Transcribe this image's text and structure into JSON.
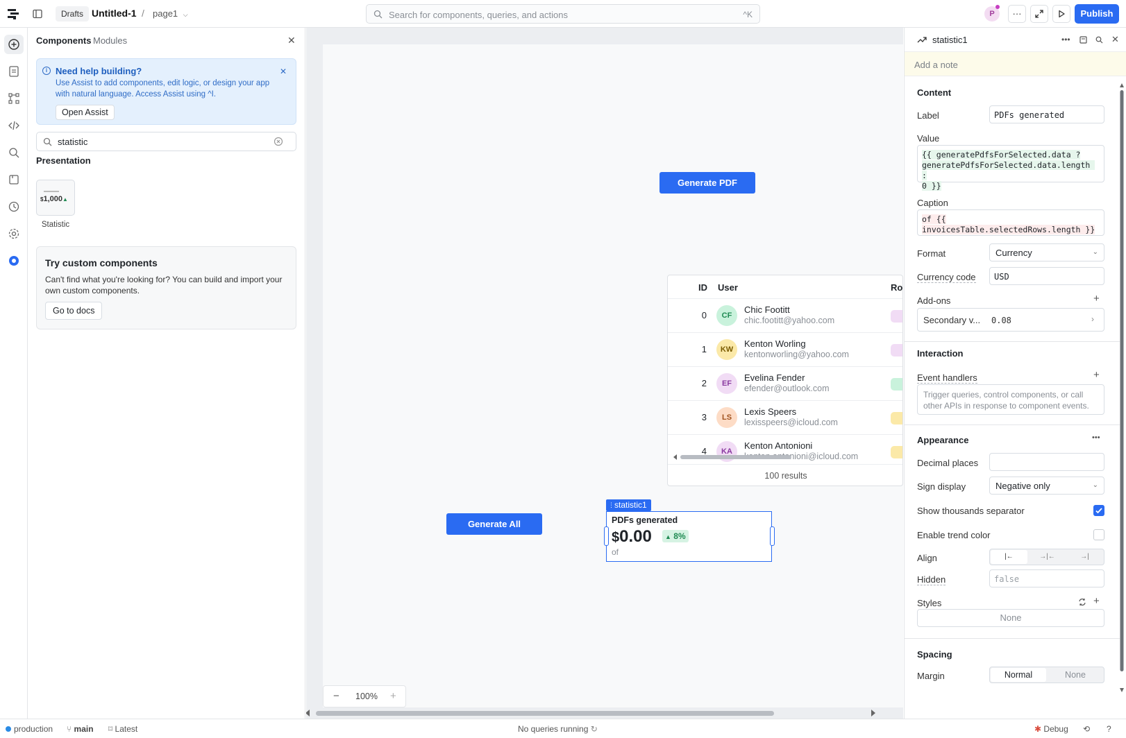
{
  "topbar": {
    "drafts": "Drafts",
    "title": "Untitled-1",
    "separator": "/",
    "page": "page1",
    "search_placeholder": "Search for components, queries, and actions",
    "search_shortcut": "^K",
    "avatar_initial": "P",
    "more": "···",
    "publish": "Publish"
  },
  "left_panel": {
    "tabs": [
      "Components",
      "Modules"
    ],
    "help": {
      "title": "Need help building?",
      "body": "Use Assist to add components, edit logic, or design your app with natural language. Access Assist using ^I.",
      "button": "Open Assist"
    },
    "search_value": "statistic",
    "section": "Presentation",
    "tile_preview_currency": "$",
    "tile_preview_value": "1,000",
    "tile_label": "Statistic",
    "custom": {
      "title": "Try custom components",
      "body": "Can't find what you're looking for? You can build and import your own custom components.",
      "button": "Go to docs"
    }
  },
  "canvas": {
    "generate_pdf": "Generate PDF",
    "generate_all": "Generate All",
    "table": {
      "headers": [
        "ID",
        "User",
        "Rol"
      ],
      "rows": [
        {
          "id": "0",
          "initials": "CF",
          "name": "Chic Footitt",
          "email": "chic.footitt@yahoo.com",
          "avatar_bg": "#c9f2dc",
          "avatar_fg": "#1f8a52",
          "role_color": "#f1dcf5"
        },
        {
          "id": "1",
          "initials": "KW",
          "name": "Kenton Worling",
          "email": "kentonworling@yahoo.com",
          "avatar_bg": "#fbe9a8",
          "avatar_fg": "#7a5b00",
          "role_color": "#f1dcf5"
        },
        {
          "id": "2",
          "initials": "EF",
          "name": "Evelina Fender",
          "email": "efender@outlook.com",
          "avatar_bg": "#f1dcf5",
          "avatar_fg": "#8a3aa0",
          "role_color": "#c9f2dc"
        },
        {
          "id": "3",
          "initials": "LS",
          "name": "Lexis Speers",
          "email": "lexisspeers@icloud.com",
          "avatar_bg": "#fddcc6",
          "avatar_fg": "#a1531f",
          "role_color": "#fbe9a8"
        },
        {
          "id": "4",
          "initials": "KA",
          "name": "Kenton Antonioni",
          "email": "kenton.antonioni@icloud.com",
          "avatar_bg": "#f1dcf5",
          "avatar_fg": "#8a3aa0",
          "role_color": "#fbe9a8"
        }
      ],
      "footer": "100 results"
    },
    "statistic": {
      "tag": "statistic1",
      "label": "PDFs generated",
      "currency": "$",
      "value": "0.00",
      "trend": "8%",
      "caption": "of"
    },
    "zoom": "100%",
    "zoom_minus": "−",
    "zoom_plus": "+"
  },
  "inspector": {
    "name": "statistic1",
    "note_placeholder": "Add a note",
    "content_title": "Content",
    "label_label": "Label",
    "label_value": "PDFs generated",
    "value_label": "Value",
    "value_code_line1": "{{ generatePdfsForSelected.data ?",
    "value_code_line2": "generatePdfsForSelected.data.length :",
    "value_code_line3": "0 }}",
    "caption_label": "Caption",
    "caption_code_line1": "of {{",
    "caption_code_line2": "invoicesTable.selectedRows.length }}",
    "format_label": "Format",
    "format_value": "Currency",
    "currency_code_label": "Currency code",
    "currency_code_value": "USD",
    "addons_label": "Add-ons",
    "secondary_label": "Secondary v...",
    "secondary_value": "0.08",
    "interaction_title": "Interaction",
    "event_handlers_label": "Event handlers",
    "event_handlers_placeholder": "Trigger queries, control components, or call other APIs in response to component events.",
    "appearance_title": "Appearance",
    "decimal_places_label": "Decimal places",
    "sign_display_label": "Sign display",
    "sign_display_value": "Negative only",
    "thousands_label": "Show thousands separator",
    "trend_color_label": "Enable trend color",
    "align_label": "Align",
    "hidden_label": "Hidden",
    "hidden_placeholder": "false",
    "styles_label": "Styles",
    "styles_value": "None",
    "spacing_title": "Spacing",
    "margin_label": "Margin",
    "margin_options": [
      "Normal",
      "None"
    ]
  },
  "statusbar": {
    "env": "production",
    "branch": "main",
    "version": "Latest",
    "queries": "No queries running",
    "debug": "Debug"
  },
  "colors": {
    "accent": "#2a6bf2",
    "trend_bg": "#d6f3e3",
    "trend_fg": "#1f8a52"
  }
}
